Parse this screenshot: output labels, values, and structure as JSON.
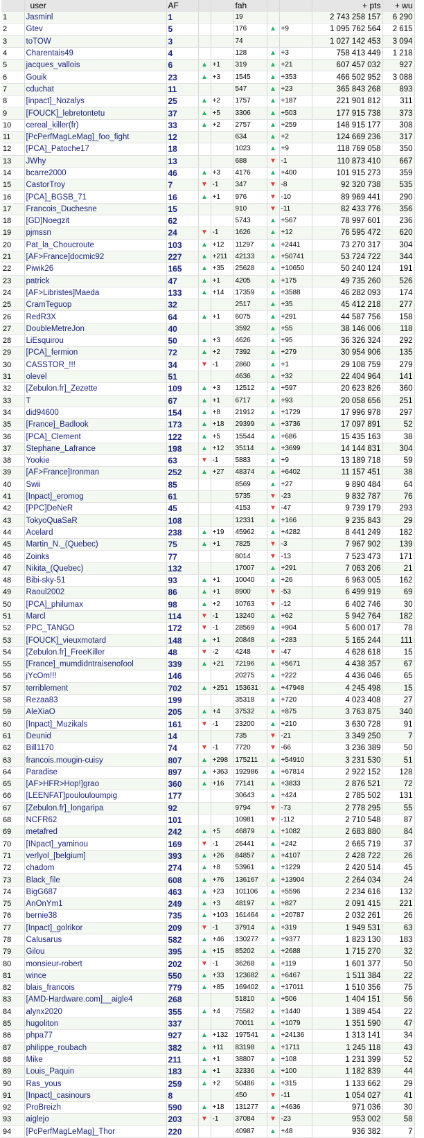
{
  "headers": {
    "rank": "",
    "user": "user",
    "af": "AF",
    "af_arrow": "",
    "af_delta": "",
    "fah": "fah",
    "fah_arrow": "",
    "fah_delta": "",
    "pts": "+ pts",
    "wu": "+ wu"
  },
  "colors": {
    "link": "#1a237e",
    "up": "#21b36b",
    "down": "#e53935",
    "row_alt": "#f3f8f1"
  },
  "rows": [
    [
      "1",
      "Jasminl",
      "1",
      "",
      "",
      "19",
      "",
      "",
      "2 743 258 157",
      "6 290"
    ],
    [
      "2",
      "Gtev",
      "5",
      "",
      "",
      "176",
      "up",
      "+9",
      "1 095 762 564",
      "2 615"
    ],
    [
      "3",
      "toTOW",
      "3",
      "",
      "",
      "74",
      "",
      "",
      "1 027 142 453",
      "3 094"
    ],
    [
      "4",
      "Charentais49",
      "4",
      "",
      "",
      "128",
      "up",
      "+3",
      "758 413 449",
      "1 218"
    ],
    [
      "5",
      "jacques_vallois",
      "6",
      "up",
      "+1",
      "319",
      "up",
      "+21",
      "607 457 032",
      "927"
    ],
    [
      "6",
      "Gouik",
      "23",
      "up",
      "+3",
      "1545",
      "up",
      "+353",
      "466 502 952",
      "3 088"
    ],
    [
      "7",
      "cduchat",
      "11",
      "",
      "",
      "547",
      "up",
      "+23",
      "365 843 268",
      "893"
    ],
    [
      "8",
      "[inpact]_Nozalys",
      "25",
      "up",
      "+2",
      "1757",
      "up",
      "+187",
      "221 901 812",
      "311"
    ],
    [
      "9",
      "[FOUCK]_lebretontetu",
      "37",
      "up",
      "+5",
      "3306",
      "up",
      "+503",
      "177 915 738",
      "373"
    ],
    [
      "10",
      "cereal_killer(fr)",
      "33",
      "up",
      "+2",
      "2757",
      "up",
      "+259",
      "148 915 177",
      "308"
    ],
    [
      "11",
      "[PcPerfMagLeMag]_foo_fight",
      "12",
      "",
      "",
      "634",
      "up",
      "+2",
      "124 669 236",
      "317"
    ],
    [
      "12",
      "[PCA]_Patoche17",
      "18",
      "",
      "",
      "1023",
      "up",
      "+9",
      "118 769 058",
      "350"
    ],
    [
      "13",
      "JWhy",
      "13",
      "",
      "",
      "688",
      "down",
      "-1",
      "110 873 410",
      "667"
    ],
    [
      "14",
      "bcarre2000",
      "46",
      "up",
      "+3",
      "4176",
      "up",
      "+400",
      "101 915 273",
      "359"
    ],
    [
      "15",
      "CastorTroy",
      "7",
      "down",
      "-1",
      "347",
      "down",
      "-8",
      "92 320 738",
      "535"
    ],
    [
      "16",
      "[PCA]_BGSB_71",
      "16",
      "up",
      "+1",
      "976",
      "down",
      "-10",
      "89 969 441",
      "290"
    ],
    [
      "17",
      "Francois_Duchesne",
      "15",
      "",
      "",
      "910",
      "down",
      "-11",
      "82 433 776",
      "356"
    ],
    [
      "18",
      "[GD]Noegzit",
      "62",
      "",
      "",
      "5743",
      "up",
      "+567",
      "78 997 601",
      "236"
    ],
    [
      "19",
      "pjmssn",
      "24",
      "down",
      "-1",
      "1626",
      "up",
      "+12",
      "76 595 472",
      "620"
    ],
    [
      "20",
      "Pat_la_Choucroute",
      "103",
      "up",
      "+12",
      "11297",
      "up",
      "+2441",
      "73 270 317",
      "304"
    ],
    [
      "21",
      "[AF>France]docmic92",
      "227",
      "up",
      "+211",
      "42133",
      "up",
      "+50741",
      "53 724 722",
      "344"
    ],
    [
      "22",
      "Piwik26",
      "165",
      "up",
      "+35",
      "25628",
      "up",
      "+10650",
      "50 240 124",
      "191"
    ],
    [
      "23",
      "patrick",
      "47",
      "up",
      "+1",
      "4205",
      "up",
      "+175",
      "49 735 260",
      "526"
    ],
    [
      "24",
      "[AF>Libristes]Maeda",
      "133",
      "up",
      "+14",
      "17359",
      "up",
      "+3588",
      "46 282 093",
      "174"
    ],
    [
      "25",
      "CramTeguop",
      "32",
      "",
      "",
      "2517",
      "up",
      "+35",
      "45 412 218",
      "277"
    ],
    [
      "26",
      "RedR3X",
      "64",
      "up",
      "+1",
      "6075",
      "up",
      "+291",
      "44 587 756",
      "158"
    ],
    [
      "27",
      "DoubleMetreJon",
      "40",
      "",
      "",
      "3592",
      "up",
      "+55",
      "38 146 006",
      "118"
    ],
    [
      "28",
      "LiEsquirou",
      "50",
      "up",
      "+3",
      "4626",
      "up",
      "+95",
      "36 326 324",
      "292"
    ],
    [
      "29",
      "[PCA]_fermion",
      "72",
      "up",
      "+2",
      "7392",
      "up",
      "+279",
      "30 954 906",
      "135"
    ],
    [
      "30",
      "CASSTOR_!!!",
      "34",
      "down",
      "-1",
      "2860",
      "up",
      "+1",
      "29 108 759",
      "279"
    ],
    [
      "31",
      "olevel",
      "51",
      "",
      "",
      "4636",
      "up",
      "+32",
      "22 404 964",
      "141"
    ],
    [
      "32",
      "[Zebulon.fr]_Zezette",
      "109",
      "up",
      "+3",
      "12512",
      "up",
      "+597",
      "20 623 826",
      "360"
    ],
    [
      "33",
      "T",
      "67",
      "up",
      "+1",
      "6717",
      "up",
      "+93",
      "20 058 656",
      "251"
    ],
    [
      "34",
      "did94600",
      "154",
      "up",
      "+8",
      "21912",
      "up",
      "+1729",
      "17 996 978",
      "297"
    ],
    [
      "35",
      "[France]_Badlook",
      "173",
      "up",
      "+18",
      "29399",
      "up",
      "+3736",
      "17 097 891",
      "52"
    ],
    [
      "36",
      "[PCA]_Clement",
      "122",
      "up",
      "+5",
      "15544",
      "up",
      "+686",
      "15 435 163",
      "38"
    ],
    [
      "37",
      "Stephane_Lafrance",
      "198",
      "up",
      "+12",
      "35114",
      "up",
      "+3699",
      "14 144 831",
      "304"
    ],
    [
      "38",
      "Yookie",
      "63",
      "down",
      "-1",
      "5883",
      "up",
      "+9",
      "13 189 718",
      "59"
    ],
    [
      "39",
      "[AF>France]Ironman",
      "252",
      "up",
      "+27",
      "48374",
      "up",
      "+6402",
      "11 157 451",
      "38"
    ],
    [
      "40",
      "Swii",
      "85",
      "",
      "",
      "8569",
      "up",
      "+27",
      "9 890 484",
      "64"
    ],
    [
      "41",
      "[Inpact]_eromog",
      "61",
      "",
      "",
      "5735",
      "down",
      "-23",
      "9 832 787",
      "76"
    ],
    [
      "42",
      "[PPC]DeNeR",
      "45",
      "",
      "",
      "4153",
      "down",
      "-47",
      "9 739 179",
      "293"
    ],
    [
      "43",
      "TokyoQuaSaR",
      "108",
      "",
      "",
      "12331",
      "up",
      "+166",
      "9 235 843",
      "29"
    ],
    [
      "44",
      "Acelard",
      "238",
      "up",
      "+19",
      "45962",
      "up",
      "+4282",
      "8 441 249",
      "182"
    ],
    [
      "45",
      "Martin_N._(Quebec)",
      "75",
      "up",
      "+1",
      "7825",
      "down",
      "-3",
      "7 967 902",
      "139"
    ],
    [
      "46",
      "Zoinks",
      "77",
      "",
      "",
      "8014",
      "down",
      "-13",
      "7 523 473",
      "171"
    ],
    [
      "47",
      "Nikita_(Quebec)",
      "132",
      "",
      "",
      "17007",
      "up",
      "+291",
      "7 063 206",
      "21"
    ],
    [
      "48",
      "Bibi-sky-51",
      "93",
      "up",
      "+1",
      "10040",
      "up",
      "+26",
      "6 963 005",
      "162"
    ],
    [
      "49",
      "Raoul2002",
      "86",
      "up",
      "+1",
      "8900",
      "down",
      "-53",
      "6 499 919",
      "69"
    ],
    [
      "50",
      "[PCA]_philumax",
      "98",
      "up",
      "+2",
      "10763",
      "down",
      "-12",
      "6 402 746",
      "30"
    ],
    [
      "51",
      "Marcl",
      "114",
      "down",
      "-1",
      "13240",
      "up",
      "+62",
      "5 942 764",
      "182"
    ],
    [
      "52",
      "PPC_TANGO",
      "172",
      "down",
      "-1",
      "28569",
      "up",
      "+904",
      "5 600 017",
      "78"
    ],
    [
      "53",
      "[FOUCK]_vieuxmotard",
      "148",
      "up",
      "+1",
      "20848",
      "up",
      "+283",
      "5 165 244",
      "111"
    ],
    [
      "54",
      "[Zebulon.fr]_FreeKiller",
      "48",
      "down",
      "-2",
      "4248",
      "down",
      "-47",
      "4 628 618",
      "15"
    ],
    [
      "55",
      "[France]_mumdidntraisenofool",
      "339",
      "up",
      "+21",
      "72196",
      "up",
      "+5671",
      "4 438 357",
      "67"
    ],
    [
      "56",
      "jYcOm!!!",
      "146",
      "",
      "",
      "20275",
      "up",
      "+222",
      "4 436 046",
      "65"
    ],
    [
      "57",
      "terriblement",
      "702",
      "up",
      "+251",
      "153631",
      "up",
      "+47948",
      "4 245 498",
      "15"
    ],
    [
      "58",
      "Rezaa83",
      "199",
      "",
      "",
      "35318",
      "up",
      "+720",
      "4 023 408",
      "27"
    ],
    [
      "59",
      "AleXiaO",
      "205",
      "up",
      "+4",
      "37532",
      "up",
      "+875",
      "3 763 875",
      "340"
    ],
    [
      "60",
      "[Inpact]_Muzikals",
      "161",
      "down",
      "-1",
      "23200",
      "up",
      "+210",
      "3 630 728",
      "91"
    ],
    [
      "61",
      "Deunid",
      "14",
      "",
      "",
      "735",
      "down",
      "-21",
      "3 349 250",
      "7"
    ],
    [
      "62",
      "Bill1170",
      "74",
      "down",
      "-1",
      "7720",
      "down",
      "-66",
      "3 236 389",
      "50"
    ],
    [
      "63",
      "francois.mougin-cuisy",
      "807",
      "up",
      "+298",
      "175211",
      "up",
      "+54910",
      "3 231 530",
      "51"
    ],
    [
      "64",
      "Paradise",
      "897",
      "up",
      "+363",
      "192986",
      "up",
      "+67814",
      "2 922 152",
      "128"
    ],
    [
      "65",
      "[AF>HFR>Hop!]grao",
      "360",
      "up",
      "+16",
      "77141",
      "up",
      "+3833",
      "2 876 521",
      "72"
    ],
    [
      "66",
      "[LEENFAT]poulouloumpig",
      "177",
      "",
      "",
      "30643",
      "up",
      "+424",
      "2 785 502",
      "131"
    ],
    [
      "67",
      "[Zebulon.fr]_longaripa",
      "92",
      "",
      "",
      "9794",
      "down",
      "-73",
      "2 778 295",
      "55"
    ],
    [
      "68",
      "NCFR62",
      "101",
      "",
      "",
      "10981",
      "down",
      "-112",
      "2 710 548",
      "87"
    ],
    [
      "69",
      "metafred",
      "242",
      "up",
      "+5",
      "46879",
      "up",
      "+1082",
      "2 683 880",
      "84"
    ],
    [
      "70",
      "[INpact]_yaminou",
      "169",
      "down",
      "-1",
      "26441",
      "up",
      "+242",
      "2 665 719",
      "37"
    ],
    [
      "71",
      "verlyol_[belgium]",
      "393",
      "up",
      "+26",
      "84857",
      "up",
      "+4107",
      "2 428 722",
      "26"
    ],
    [
      "72",
      "chadom",
      "274",
      "up",
      "+8",
      "53961",
      "up",
      "+1229",
      "2 420 514",
      "45"
    ],
    [
      "73",
      "Black_file",
      "608",
      "up",
      "+76",
      "136167",
      "up",
      "+13904",
      "2 264 034",
      "24"
    ],
    [
      "74",
      "BigG687",
      "463",
      "up",
      "+23",
      "101106",
      "up",
      "+5596",
      "2 234 616",
      "132"
    ],
    [
      "75",
      "AnOnYm1",
      "249",
      "up",
      "+3",
      "48197",
      "up",
      "+827",
      "2 091 415",
      "221"
    ],
    [
      "76",
      "bernie38",
      "735",
      "up",
      "+103",
      "161464",
      "up",
      "+20787",
      "2 032 261",
      "26"
    ],
    [
      "77",
      "[Inpact]_golrikor",
      "209",
      "down",
      "-1",
      "37914",
      "up",
      "+319",
      "1 949 531",
      "63"
    ],
    [
      "78",
      "Calusarus",
      "582",
      "up",
      "+46",
      "130277",
      "up",
      "+9377",
      "1 823 130",
      "183"
    ],
    [
      "79",
      "Gilou",
      "395",
      "up",
      "+15",
      "85202",
      "up",
      "+2688",
      "1 715 270",
      "32"
    ],
    [
      "80",
      "monsieur-robert",
      "202",
      "down",
      "-1",
      "36268",
      "up",
      "+119",
      "1 601 377",
      "50"
    ],
    [
      "81",
      "wince",
      "550",
      "up",
      "+33",
      "123682",
      "up",
      "+6467",
      "1 511 384",
      "22"
    ],
    [
      "82",
      "blais_francois",
      "779",
      "up",
      "+85",
      "169402",
      "up",
      "+17011",
      "1 510 356",
      "75"
    ],
    [
      "83",
      "[AMD-Hardware.com]__aigle4",
      "268",
      "",
      "",
      "51810",
      "up",
      "+506",
      "1 404 151",
      "56"
    ],
    [
      "84",
      "alynx2020",
      "355",
      "up",
      "+4",
      "75582",
      "up",
      "+1440",
      "1 389 454",
      "22"
    ],
    [
      "85",
      "hugoliton",
      "337",
      "",
      "",
      "70011",
      "up",
      "+1079",
      "1 351 590",
      "47"
    ],
    [
      "86",
      "phpa77",
      "927",
      "up",
      "+132",
      "197541",
      "up",
      "+24136",
      "1 313 141",
      "34"
    ],
    [
      "87",
      "philippe_roubach",
      "382",
      "up",
      "+11",
      "83198",
      "up",
      "+1711",
      "1 245 118",
      "43"
    ],
    [
      "88",
      "Mike",
      "211",
      "up",
      "+1",
      "38807",
      "up",
      "+108",
      "1 231 399",
      "52"
    ],
    [
      "89",
      "Louis_Paquin",
      "183",
      "up",
      "+1",
      "32336",
      "up",
      "+100",
      "1 182 839",
      "44"
    ],
    [
      "90",
      "Ras_yous",
      "259",
      "up",
      "+2",
      "50486",
      "up",
      "+315",
      "1 133 662",
      "29"
    ],
    [
      "91",
      "[Inpact]_casinours",
      "8",
      "",
      "",
      "450",
      "down",
      "-11",
      "1 054 027",
      "41"
    ],
    [
      "92",
      "ProBreizh",
      "590",
      "up",
      "+18",
      "131277",
      "up",
      "+4636",
      "971 036",
      "30"
    ],
    [
      "93",
      "aiglejo",
      "203",
      "down",
      "-1",
      "37084",
      "down",
      "-23",
      "953 002",
      "58"
    ],
    [
      "94",
      "[PcPerfMagLeMag]_Thor",
      "220",
      "",
      "",
      "40987",
      "up",
      "+48",
      "936 382",
      "7"
    ]
  ]
}
